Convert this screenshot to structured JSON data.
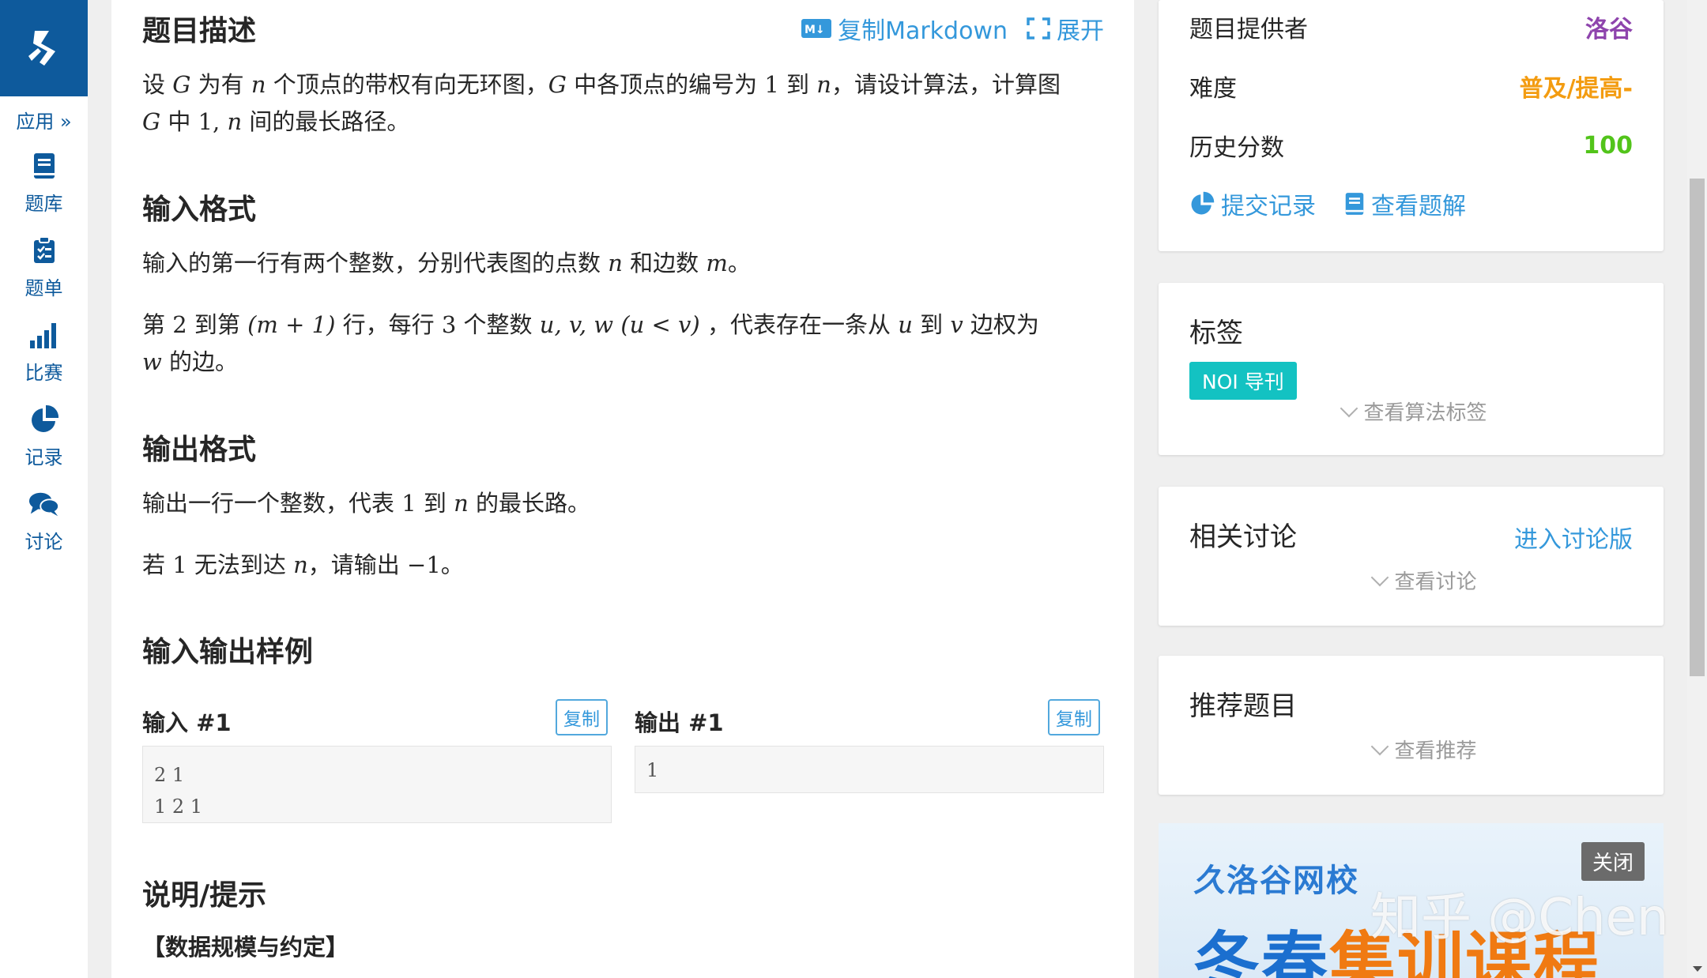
{
  "sidebar": {
    "app_label": "应用 »",
    "items": [
      {
        "label": "题库",
        "icon": "book-icon"
      },
      {
        "label": "题单",
        "icon": "clipboard-icon"
      },
      {
        "label": "比赛",
        "icon": "bar-chart-icon"
      },
      {
        "label": "记录",
        "icon": "pie-chart-icon"
      },
      {
        "label": "讨论",
        "icon": "chat-icon"
      }
    ]
  },
  "main": {
    "links": {
      "copy_markdown": "复制Markdown",
      "expand": "展开"
    },
    "description": {
      "title": "题目描述",
      "line1_a": "设 ",
      "G1": "G",
      "line1_b": " 为有 ",
      "n1": "n",
      "line1_c": " 个顶点的带权有向无环图，",
      "G2": "G",
      "line1_d": " 中各顶点的编号为 ",
      "one1": "1",
      "line1_e": " 到 ",
      "n2": "n",
      "line1_f": "，请设计算法，计算图",
      "G3": "G",
      "line2_a": " 中 ",
      "onen": "1, ",
      "n3": "n",
      "line2_b": " 间的最长路径。"
    },
    "input_format": {
      "title": "输入格式",
      "p1_a": "输入的第一行有两个整数，分别代表图的点数 ",
      "p1_n": "n",
      "p1_b": " 和边数 ",
      "p1_m": "m",
      "p1_c": "。",
      "p2_a": "第 ",
      "p2_2": "2",
      "p2_b": " 到第 ",
      "p2_expr": "(m + 1)",
      "p2_c": " 行，每行 ",
      "p2_3": "3",
      "p2_d": " 个整数 ",
      "p2_uvw": "u, v, w",
      "p2_e": " ",
      "p2_cond": "(u < v)",
      "p2_f": " ，代表存在一条从 ",
      "p2_u": "u",
      "p2_g": " 到 ",
      "p2_v": "v",
      "p2_h": " 边权为",
      "p3_w": "w",
      "p3_a": " 的边。"
    },
    "output_format": {
      "title": "输出格式",
      "p1_a": "输出一行一个整数，代表 ",
      "p1_1": "1",
      "p1_b": " 到 ",
      "p1_n": "n",
      "p1_c": " 的最长路。",
      "p2_a": "若 ",
      "p2_1": "1",
      "p2_b": " 无法到达 ",
      "p2_n": "n",
      "p2_c": "，请输出 ",
      "p2_neg": "−1",
      "p2_d": "。"
    },
    "samples": {
      "title": "输入输出样例",
      "input_label": "输入 #1",
      "output_label": "输出 #1",
      "copy": "复制",
      "input_lines": [
        "2 1",
        "1 2 1"
      ],
      "output_lines": [
        "1"
      ]
    },
    "hint": {
      "title": "说明/提示",
      "sub": "【数据规模与约定】"
    }
  },
  "info": {
    "provider_label": "题目提供者",
    "provider_value": "洛谷",
    "difficulty_label": "难度",
    "difficulty_value": "普及/提高-",
    "score_label": "历史分数",
    "score_value": "100",
    "submit_records": "提交记录",
    "view_solutions": "查看题解"
  },
  "tags": {
    "title": "标签",
    "tag": "NOI 导刊",
    "more": "查看算法标签"
  },
  "discussion": {
    "title": "相关讨论",
    "link": "进入讨论版",
    "more": "查看讨论"
  },
  "recommend": {
    "title": "推荐题目",
    "more": "查看推荐"
  },
  "ad": {
    "brand": "洛谷网校",
    "close": "关闭",
    "headline_a": "冬春",
    "headline_b": "集训课程"
  },
  "watermark": "知乎 @Chen",
  "colors": {
    "brand_blue": "#0e5a9c",
    "link_blue": "#3498db",
    "provider_purple": "#8e44ad",
    "difficulty_orange": "#f39c11",
    "score_green": "#52c41a",
    "tag_teal": "#13c2c2"
  }
}
